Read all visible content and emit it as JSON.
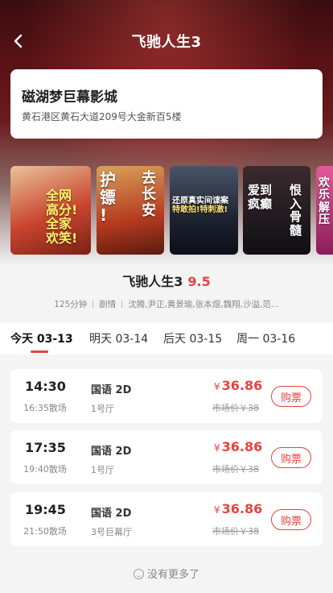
{
  "nav": {
    "title": "飞驰人生3",
    "back_icon": "chevron-left-icon"
  },
  "cinema": {
    "name": "磁湖梦巨幕影城",
    "address": "黄石港区黄石大道209号大金新百5楼"
  },
  "posters": [
    {
      "lines": [
        "全网",
        "高分!",
        "全家",
        "欢笑!"
      ],
      "colors": [
        "#c9462e",
        "#e9c39a"
      ]
    },
    {
      "lines": [
        "护",
        "镖",
        "!",
        "去长安"
      ],
      "colors": [
        "#b63a1f",
        "#d9a25a"
      ]
    },
    {
      "lines": [
        "还原真实间谍案",
        "特敢拍!特刺激!"
      ],
      "colors": [
        "#1c2230",
        "#4a5468"
      ]
    },
    {
      "lines": [
        "爱到疯癫",
        "恨入骨髓"
      ],
      "colors": [
        "#0f0f14",
        "#3b2a2e"
      ]
    },
    {
      "lines": [
        "欢",
        "乐",
        "解",
        "压"
      ],
      "colors": [
        "#8a1d5a",
        "#e45a9a"
      ]
    }
  ],
  "movie": {
    "title": "飞驰人生3",
    "score": "9.5",
    "duration": "125分钟",
    "genre": "剧情",
    "cast": "沈腾,尹正,黄景瑜,张本煜,魏翔,沙溢,范..."
  },
  "tabs": [
    {
      "label": "今天 03-13",
      "active": true
    },
    {
      "label": "明天 03-14",
      "active": false
    },
    {
      "label": "后天 03-15",
      "active": false
    },
    {
      "label": "周一 03-16",
      "active": false
    }
  ],
  "showtimes": [
    {
      "start": "14:30",
      "end": "16:35散场",
      "lang": "国语 2D",
      "hall": "1号厅",
      "currency": "¥",
      "price": "36.86",
      "market": "市场价￥38",
      "buy": "购票"
    },
    {
      "start": "17:35",
      "end": "19:40散场",
      "lang": "国语 2D",
      "hall": "1号厅",
      "currency": "¥",
      "price": "36.86",
      "market": "市场价￥38",
      "buy": "购票"
    },
    {
      "start": "19:45",
      "end": "21:50散场",
      "lang": "国语 2D",
      "hall": "3号巨幕厅",
      "currency": "¥",
      "price": "36.86",
      "market": "市场价￥38",
      "buy": "购票"
    }
  ],
  "footer": {
    "no_more": "没有更多了",
    "icon": "smile-icon"
  },
  "colors": {
    "accent": "#e8423f"
  }
}
